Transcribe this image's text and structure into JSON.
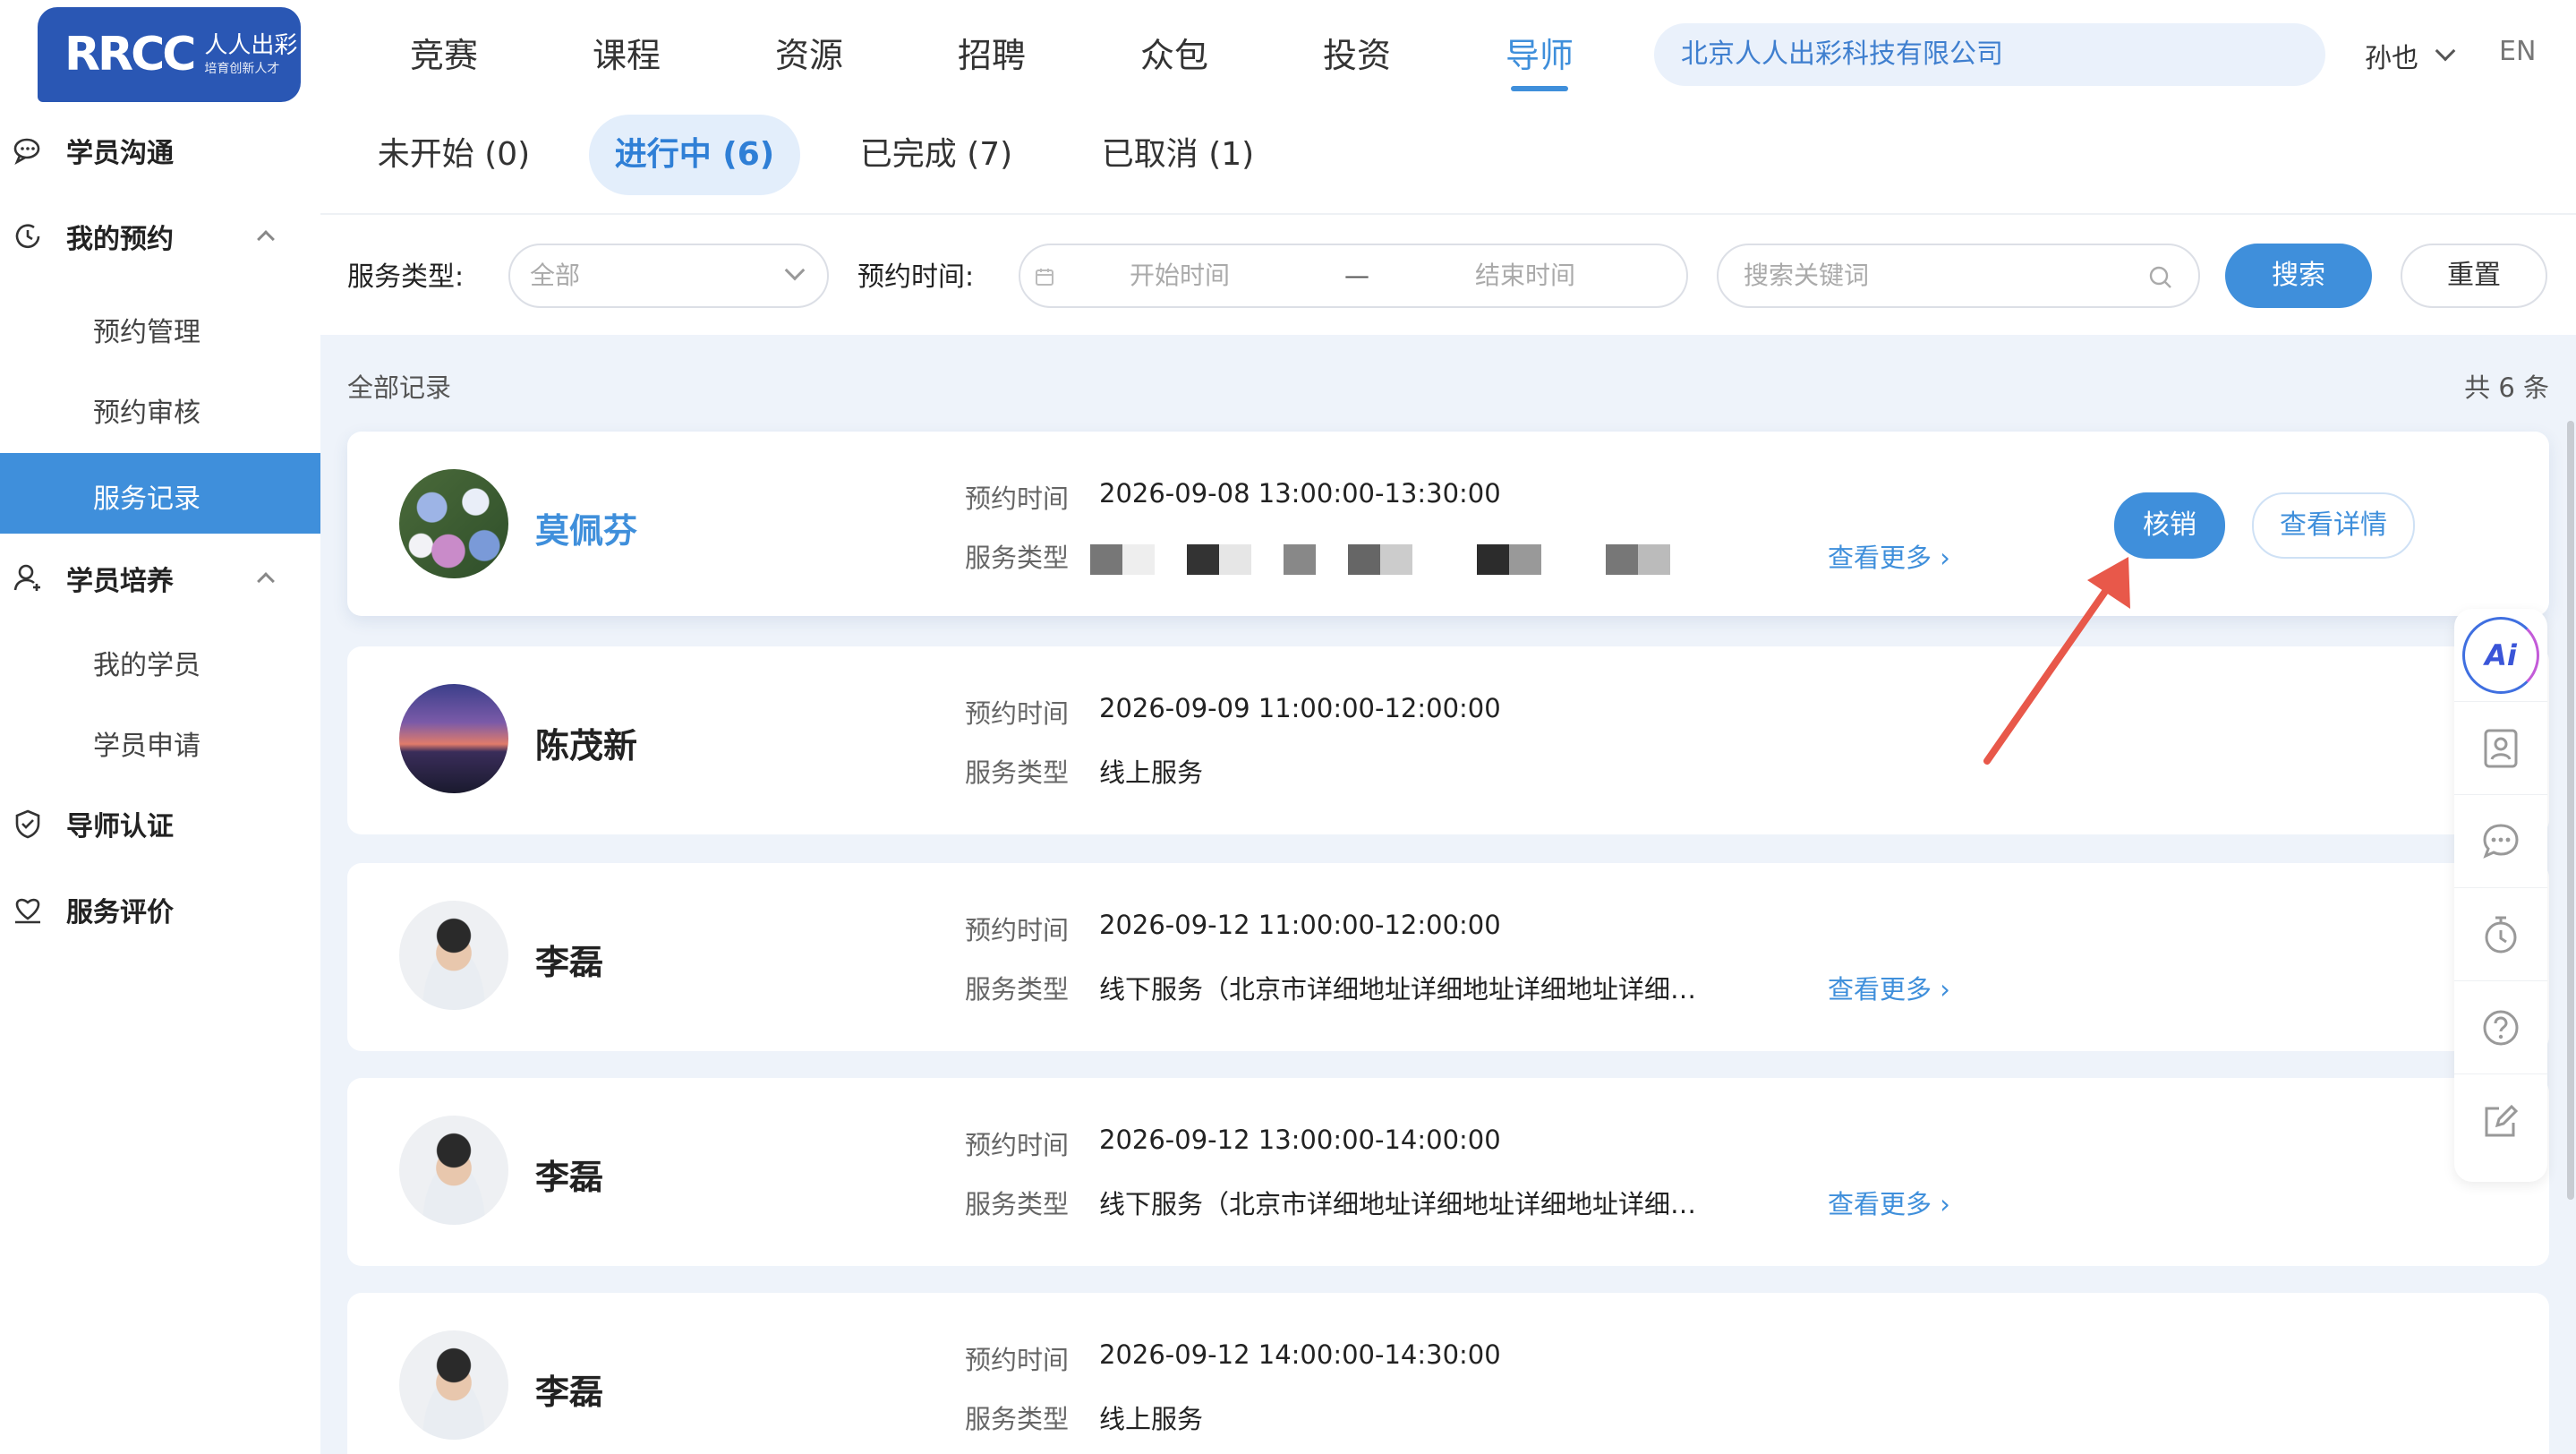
{
  "brand": {
    "mark": "RRCC",
    "name_cn": "人人出彩",
    "tagline": "培育创新人才"
  },
  "topnav": [
    "竞赛",
    "课程",
    "资源",
    "招聘",
    "众包",
    "投资",
    "导师"
  ],
  "company": "北京人人出彩科技有限公司",
  "user": "孙也",
  "lang": "EN",
  "sidebar": {
    "communicate": "学员沟通",
    "my_booking": "我的预约",
    "booking_mgmt": "预约管理",
    "booking_review": "预约审核",
    "service_records": "服务记录",
    "training": "学员培养",
    "my_students": "我的学员",
    "student_apply": "学员申请",
    "certification": "导师认证",
    "service_eval": "服务评价"
  },
  "tabs": [
    "未开始 (0)",
    "进行中 (6)",
    "已完成 (7)",
    "已取消 (1)"
  ],
  "filters": {
    "service_type_label": "服务类型:",
    "service_type_value": "全部",
    "time_label": "预约时间:",
    "start_ph": "开始时间",
    "dash": "—",
    "end_ph": "结束时间",
    "keyword_ph": "搜索关键词",
    "search_btn": "搜索",
    "reset_btn": "重置"
  },
  "records": {
    "title": "全部记录",
    "count": "共 6 条",
    "time_label": "预约时间",
    "type_label": "服务类型",
    "more": "查看更多 ›",
    "items": [
      {
        "name": "莫佩芬",
        "time": "2026-09-08 13:00:00-13:30:00",
        "type": ""
      },
      {
        "name": "陈茂新",
        "time": "2026-09-09 11:00:00-12:00:00",
        "type": "线上服务"
      },
      {
        "name": "李磊",
        "time": "2026-09-12 11:00:00-12:00:00",
        "type": "线下服务（北京市详细地址详细地址详细地址详细…"
      },
      {
        "name": "李磊",
        "time": "2026-09-12 13:00:00-14:00:00",
        "type": "线下服务（北京市详细地址详细地址详细地址详细…"
      },
      {
        "name": "李磊",
        "time": "2026-09-12 14:00:00-14:30:00",
        "type": "线上服务"
      }
    ],
    "verify_btn": "核销",
    "detail_btn": "查看详情"
  },
  "floatbar": {
    "ai": "Ai"
  },
  "colors": {
    "primary": "#3f8fdb",
    "logo": "#2a57b4",
    "arrow": "#e8584a",
    "bg": "#eef3fa"
  }
}
